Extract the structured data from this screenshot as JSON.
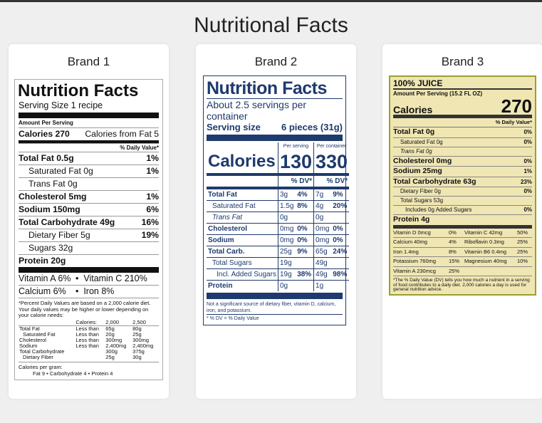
{
  "page_title": "Nutritional Facts",
  "brands": [
    {
      "title": "Brand 1",
      "label": {
        "heading": "Nutrition Facts",
        "serving_size": "Serving Size 1 recipe",
        "amount_per_serving": "Amount Per Serving",
        "calories": "Calories 270",
        "calories_from_fat": "Calories from Fat 5",
        "dv_header": "% Daily Value*",
        "rows": [
          {
            "name": "Total Fat 0.5g",
            "dv": "1%"
          },
          {
            "name": "Saturated Fat 0g",
            "dv": "1%"
          },
          {
            "name": "Trans Fat 0g",
            "dv": ""
          },
          {
            "name": "Cholesterol 5mg",
            "dv": "1%"
          },
          {
            "name": "Sodium 150mg",
            "dv": "6%"
          },
          {
            "name": "Total Carbohydrate 49g",
            "dv": "16%"
          },
          {
            "name": "Dietary Fiber 5g",
            "dv": "19%"
          },
          {
            "name": "Sugars 32g",
            "dv": ""
          },
          {
            "name": "Protein 20g",
            "dv": ""
          }
        ],
        "vitamins": [
          {
            "a": "Vitamin A 6%",
            "b": "Vitamin C 210%"
          },
          {
            "a": "Calcium 6%",
            "b": "Iron 8%"
          }
        ],
        "footnote": "*Percent Daily Values are based on a 2,000 calorie diet. Your daily values may be higher or lower depending on your calorie needs:",
        "table_header": [
          "",
          "Calories:",
          "2,000",
          "2,500"
        ],
        "table_rows": [
          [
            "Total Fat",
            "Less than",
            "65g",
            "80g"
          ],
          [
            "Saturated Fat",
            "Less than",
            "20g",
            "25g"
          ],
          [
            "Cholesterol",
            "Less than",
            "300mg",
            "300mg"
          ],
          [
            "Sodium",
            "Less than",
            "2,400mg",
            "2,400mg"
          ],
          [
            "Total Carbohydrate",
            "",
            "300g",
            "375g"
          ],
          [
            "Dietary Fiber",
            "",
            "25g",
            "30g"
          ]
        ],
        "calories_per_gram": "Calories per gram:",
        "calories_per_gram_values": "Fat 9  •  Carbohydrate 4  •  Protein 4"
      }
    },
    {
      "title": "Brand 2",
      "label": {
        "heading": "Nutrition Facts",
        "servings": "About 2.5 servings per container",
        "serving_size_label": "Serving size",
        "serving_size_value": "6 pieces (31g)",
        "col_per_serving": "Per serving",
        "col_per_container": "Per container",
        "calories_label": "Calories",
        "calories_serving": "130",
        "calories_container": "330",
        "dv_header": "% DV*",
        "rows": [
          {
            "name": "Total Fat",
            "s_amt": "3g",
            "s_dv": "4%",
            "c_amt": "7g",
            "c_dv": "9%"
          },
          {
            "name": "Saturated Fat",
            "s_amt": "1.5g",
            "s_dv": "8%",
            "c_amt": "4g",
            "c_dv": "20%"
          },
          {
            "name": "Trans Fat",
            "s_amt": "0g",
            "s_dv": "",
            "c_amt": "0g",
            "c_dv": ""
          },
          {
            "name": "Cholesterol",
            "s_amt": "0mg",
            "s_dv": "0%",
            "c_amt": "0mg",
            "c_dv": "0%"
          },
          {
            "name": "Sodium",
            "s_amt": "0mg",
            "s_dv": "0%",
            "c_amt": "0mg",
            "c_dv": "0%"
          },
          {
            "name": "Total Carb.",
            "s_amt": "25g",
            "s_dv": "9%",
            "c_amt": "65g",
            "c_dv": "24%"
          },
          {
            "name": "Total Sugars",
            "s_amt": "19g",
            "s_dv": "",
            "c_amt": "49g",
            "c_dv": ""
          },
          {
            "name": "Incl. Added Sugars",
            "s_amt": "19g",
            "s_dv": "38%",
            "c_amt": "49g",
            "c_dv": "98%"
          },
          {
            "name": "Protein",
            "s_amt": "0g",
            "s_dv": "",
            "c_amt": "1g",
            "c_dv": ""
          }
        ],
        "footnote": "Not a significant source of dietary fiber, vitamin D, calcium, iron, and potassium.",
        "footnote2": "* % DV = % Daily Value"
      }
    },
    {
      "title": "Brand 3",
      "label": {
        "juice": "100% JUICE",
        "amount_per_serving": "Amount Per Serving (15.2 FL OZ)",
        "calories_label": "Calories",
        "calories_value": "270",
        "dv_header": "% Daily Value*",
        "rows": [
          {
            "name": "Total Fat 0g",
            "dv": "0%"
          },
          {
            "name": "Saturated Fat 0g",
            "dv": "0%"
          },
          {
            "name": "Trans Fat 0g",
            "dv": ""
          },
          {
            "name": "Cholesterol 0mg",
            "dv": "0%"
          },
          {
            "name": "Sodium 25mg",
            "dv": "1%"
          },
          {
            "name": "Total Carbohydrate 63g",
            "dv": "23%"
          },
          {
            "name": "Dietary Fiber 0g",
            "dv": "0%"
          },
          {
            "name": "Total Sugars 53g",
            "dv": ""
          },
          {
            "name": "Includes 0g Added Sugars",
            "dv": "0%"
          },
          {
            "name": "Protein 4g",
            "dv": ""
          }
        ],
        "vitamins": [
          [
            "Vitamin D 0mcg",
            "0%",
            "Vitamin C 42mg",
            "50%"
          ],
          [
            "Calcium 40mg",
            "4%",
            "Riboflavin 0.3mg",
            "25%"
          ],
          [
            "Iron 1.4mg",
            "8%",
            "Vitamin B6 0.4mg",
            "25%"
          ],
          [
            "Potassium 760mg",
            "15%",
            "Magnesium 40mg",
            "10%"
          ],
          [
            "Vitamin A 230mcg",
            "25%",
            "",
            ""
          ]
        ],
        "footnote": "*The % Daily Value (DV) tells you how much a nutrient in a serving of food contributes to a daily diet. 2,000 calories a day is used for general nutrition advice."
      }
    }
  ]
}
